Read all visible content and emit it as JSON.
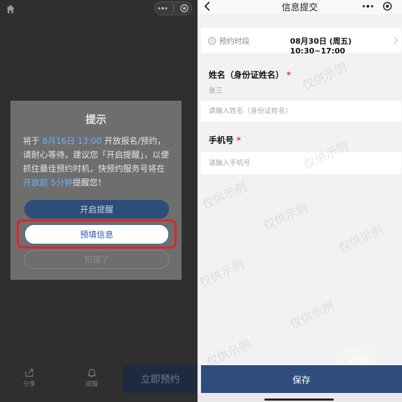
{
  "left_screen": {
    "modal": {
      "title": "提示",
      "message": {
        "part1": "将于 ",
        "time": "8月16日 13:00",
        "part2": " 开放报名/预约，请耐心等待。建议您「开启提醒」，以便抓住最佳预约时机，快预约服务号将在",
        "open_before": "开放前 5分钟",
        "part3": "提醒您！"
      },
      "btn_enable_reminder": "开启提醒",
      "btn_prefill": "预填信息",
      "btn_got_it": "知道了"
    },
    "tabbar": {
      "share_label": "分享",
      "remind_label": "提醒",
      "book_now_label": "立即预约"
    },
    "colors": {
      "highlight_border": "#e0232d",
      "link_blue": "#6fb0f5"
    }
  },
  "right_screen": {
    "nav": {
      "title": "信息提交"
    },
    "time_slot": {
      "label": "预约时段",
      "value": "08月30日 (周五) 10:30~17:00"
    },
    "name_field": {
      "label": "姓名（身份证姓名）",
      "required_mark": "*",
      "example": "张三",
      "placeholder": "请输入姓名（身份证姓名）"
    },
    "phone_field": {
      "label": "手机号",
      "required_mark": "*",
      "placeholder": "请输入手机号"
    },
    "save_button": "保存",
    "watermark": "仅供示例",
    "colors": {
      "primary": "#2f4d7c",
      "required": "#e03b3b"
    }
  }
}
